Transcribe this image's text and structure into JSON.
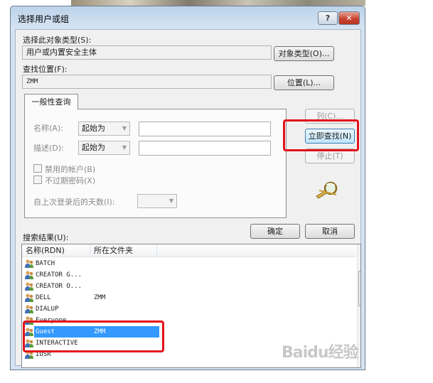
{
  "window": {
    "title": "选择用户或组",
    "help_label": "?",
    "close_label": "✕"
  },
  "object_type": {
    "label": "选择此对象类型(S):",
    "value": "用户或内置安全主体",
    "button": "对象类型(O)..."
  },
  "location": {
    "label": "查找位置(F):",
    "value": "ZMM",
    "button": "位置(L)..."
  },
  "tab": {
    "label": "一般性查询"
  },
  "query": {
    "name_label": "名称(A):",
    "desc_label": "描述(D):",
    "starts_with": "起始为",
    "disabled_accounts": "禁用的帐户(B)",
    "non_expiring_pwd": "不过期密码(X)",
    "days_since_logon": "自上次登录后的天数(I):"
  },
  "buttons": {
    "columns": "列(C)...",
    "find_now": "立即查找(N)",
    "stop": "停止(T)",
    "ok": "确定",
    "cancel": "取消"
  },
  "results": {
    "label": "搜索结果(U):",
    "columns": [
      "名称(RDN)",
      "所在文件夹"
    ],
    "rows": [
      {
        "name": "BATCH",
        "folder": ""
      },
      {
        "name": "CREATOR G...",
        "folder": ""
      },
      {
        "name": "CREATOR O...",
        "folder": ""
      },
      {
        "name": "DELL",
        "folder": "ZMM"
      },
      {
        "name": "DIALUP",
        "folder": ""
      },
      {
        "name": "Everyone",
        "folder": ""
      },
      {
        "name": "Guest",
        "folder": "ZMM",
        "selected": true
      },
      {
        "name": "INTERACTIVE",
        "folder": ""
      },
      {
        "name": "IUSR",
        "folder": ""
      }
    ]
  },
  "watermark": "Baidu经验",
  "colors": {
    "highlight_box": "#e3131b",
    "selection": "#3399ff"
  }
}
